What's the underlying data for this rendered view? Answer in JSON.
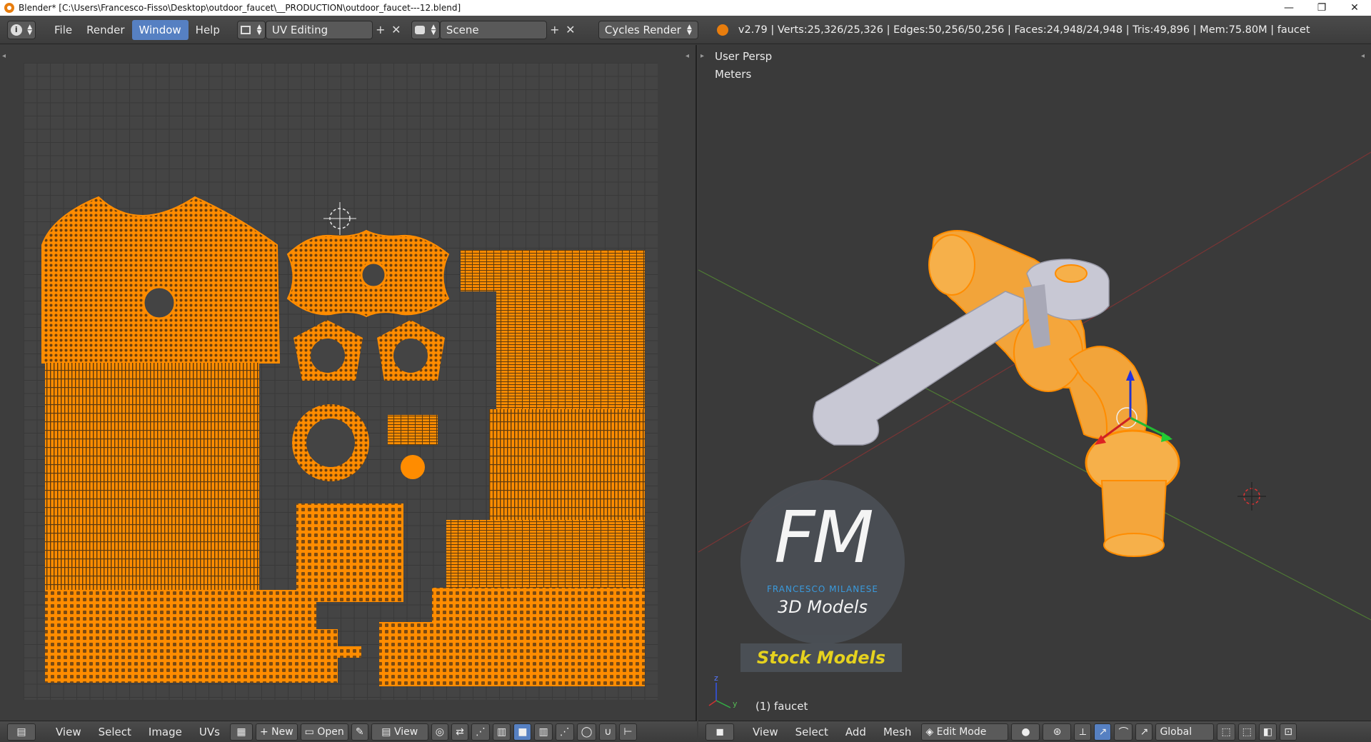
{
  "titlebar": {
    "title": "Blender* [C:\\Users\\Francesco-Fisso\\Desktop\\outdoor_faucet\\__PRODUCTION\\outdoor_faucet---12.blend]",
    "minimize": "—",
    "restore": "❐",
    "close": "✕"
  },
  "topbar": {
    "menus": [
      "File",
      "Render",
      "Window",
      "Help"
    ],
    "active_menu": "Window",
    "screen_layout": "UV Editing",
    "scene": "Scene",
    "render_engine": "Cycles Render",
    "stats": "v2.79 | Verts:25,326/25,326 | Edges:50,256/50,256 | Faces:24,948/24,948 | Tris:49,896 | Mem:75.80M | faucet"
  },
  "view3d": {
    "persp_label": "User Persp",
    "units_label": "Meters",
    "object_label": "(1) faucet",
    "axis_x": "x",
    "axis_y": "y",
    "axis_z": "z"
  },
  "logo": {
    "initials": "FM",
    "name": "FRANCESCO MILANESE",
    "subtitle": "3D Models",
    "banner": "Stock Models"
  },
  "uv_header": {
    "menus": [
      "View",
      "Select",
      "Image",
      "UVs"
    ],
    "new_label": "New",
    "open_label": "Open",
    "view_label": "View"
  },
  "view3d_header": {
    "menus": [
      "View",
      "Select",
      "Add",
      "Mesh"
    ],
    "mode": "Edit Mode",
    "orientation": "Global"
  },
  "colors": {
    "uv_orange": "#ff8c00",
    "selection_blue": "#5680c2",
    "logo_blue": "#3aa0e6",
    "banner_yellow": "#e6d21e"
  }
}
